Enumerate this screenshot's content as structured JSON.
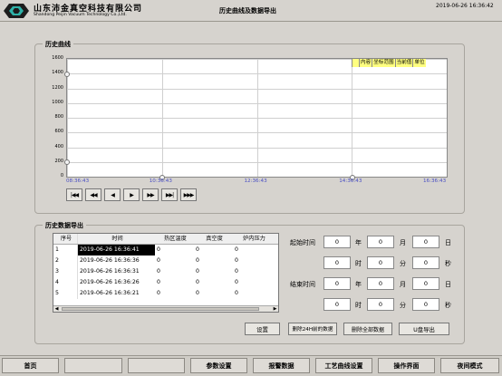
{
  "header": {
    "company_cn": "山东沛金真空科技有限公司",
    "company_en": "Shandong Peijin Vacuum Technology Co.,Ltd.",
    "title": "历史曲线及数据导出",
    "datetime": "2019-06-26 16:36:42"
  },
  "history_curve": {
    "group_title": "历史曲线",
    "legend": [
      "内容",
      "坐标范围",
      "当前值",
      "单位"
    ],
    "nav_buttons": [
      "|◀◀",
      "◀◀",
      "◀",
      "▶",
      "▶▶",
      "▶▶|",
      "▶▶▶"
    ],
    "chart_data": {
      "type": "line",
      "title": "",
      "y_ticks": [
        "1600",
        "1400",
        "1200",
        "1000",
        "800",
        "600",
        "400",
        "200",
        "0"
      ],
      "ylim": [
        0,
        1600
      ],
      "x_ticks": [
        "08:36:43",
        "10:36:43",
        "12:36:43",
        "14:36:43",
        "16:36:43"
      ],
      "series": [],
      "grid": true
    }
  },
  "export": {
    "group_title": "历史数据导出",
    "columns": [
      "序号",
      "时间",
      "热区温度",
      "真空度",
      "炉内压力"
    ],
    "rows": [
      {
        "no": "1",
        "time": "2019-06-26 16:36:41",
        "temp": "0",
        "vac": "0",
        "press": "0"
      },
      {
        "no": "2",
        "time": "2019-06-26 16:36:36",
        "temp": "0",
        "vac": "0",
        "press": "0"
      },
      {
        "no": "3",
        "time": "2019-06-26 16:36:31",
        "temp": "0",
        "vac": "0",
        "press": "0"
      },
      {
        "no": "4",
        "time": "2019-06-26 16:36:26",
        "temp": "0",
        "vac": "0",
        "press": "0"
      },
      {
        "no": "5",
        "time": "2019-06-26 16:36:21",
        "temp": "0",
        "vac": "0",
        "press": "0"
      }
    ],
    "setup_button": "设置",
    "start_label": "起始时间",
    "end_label": "结束时间",
    "unit_year": "年",
    "unit_month": "月",
    "unit_day": "日",
    "unit_hour": "时",
    "unit_minute": "分",
    "unit_second": "秒",
    "start": {
      "year": "0",
      "month": "0",
      "day": "0",
      "hour": "0",
      "minute": "0",
      "second": "0"
    },
    "end": {
      "year": "0",
      "month": "0",
      "day": "0",
      "hour": "0",
      "minute": "0",
      "second": "0"
    },
    "delete_48h_button": "删除24H前的数据",
    "delete_all_button": "删除全部数据",
    "usb_export_button": "U盘导出"
  },
  "footer": {
    "buttons": [
      "首页",
      "",
      "",
      "参数设置",
      "报警数据",
      "工艺曲线设置",
      "操作界面",
      "夜间模式"
    ]
  },
  "colors": {
    "background": "#d6d3ce",
    "legend_bg": "#ffff80",
    "x_tick": "#4a4fc4"
  }
}
